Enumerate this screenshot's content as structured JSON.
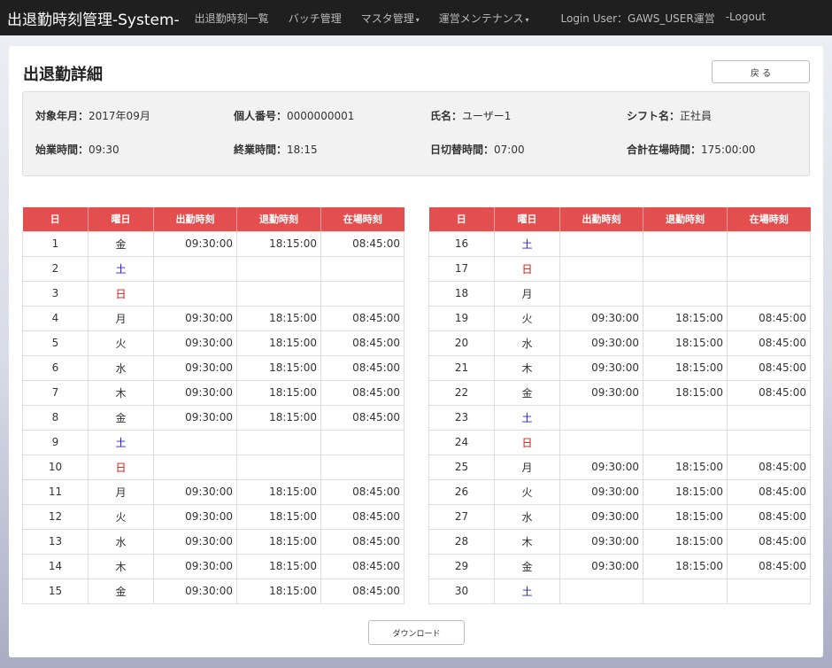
{
  "nav": {
    "brand": "出退勤時刻管理-System-",
    "items": [
      "出退勤時刻一覧",
      "バッチ管理",
      "マスタ管理",
      "運営メンテナンス"
    ],
    "caret": "▾",
    "login": "Login User：GAWS_USER運営",
    "logout": "-Logout"
  },
  "page": {
    "title": "出退勤詳細",
    "back_label": "戻 る",
    "download_label": "ダウンロード"
  },
  "info": {
    "month_label": "対象年月：",
    "month": "2017年09月",
    "id_label": "個人番号：",
    "id": "0000000001",
    "name_label": "氏名：",
    "name": "ユーザー1",
    "shift_label": "シフト名：",
    "shift": "正社員",
    "start_label": "始業時間：",
    "start": "09:30",
    "end_label": "終業時間：",
    "end": "18:15",
    "daycut_label": "日切替時間：",
    "daycut": "07:00",
    "total_label": "合計在場時間：",
    "total": "175:00:00"
  },
  "table": {
    "headers": [
      "日",
      "曜日",
      "出勤時刻",
      "退勤時刻",
      "在場時刻"
    ],
    "left_rows": [
      [
        "1",
        "金",
        "09:30:00",
        "18:15:00",
        "08:45:00"
      ],
      [
        "2",
        "土",
        "",
        "",
        ""
      ],
      [
        "3",
        "日",
        "",
        "",
        ""
      ],
      [
        "4",
        "月",
        "09:30:00",
        "18:15:00",
        "08:45:00"
      ],
      [
        "5",
        "火",
        "09:30:00",
        "18:15:00",
        "08:45:00"
      ],
      [
        "6",
        "水",
        "09:30:00",
        "18:15:00",
        "08:45:00"
      ],
      [
        "7",
        "木",
        "09:30:00",
        "18:15:00",
        "08:45:00"
      ],
      [
        "8",
        "金",
        "09:30:00",
        "18:15:00",
        "08:45:00"
      ],
      [
        "9",
        "土",
        "",
        "",
        ""
      ],
      [
        "10",
        "日",
        "",
        "",
        ""
      ],
      [
        "11",
        "月",
        "09:30:00",
        "18:15:00",
        "08:45:00"
      ],
      [
        "12",
        "火",
        "09:30:00",
        "18:15:00",
        "08:45:00"
      ],
      [
        "13",
        "水",
        "09:30:00",
        "18:15:00",
        "08:45:00"
      ],
      [
        "14",
        "木",
        "09:30:00",
        "18:15:00",
        "08:45:00"
      ],
      [
        "15",
        "金",
        "09:30:00",
        "18:15:00",
        "08:45:00"
      ]
    ],
    "right_rows": [
      [
        "16",
        "土",
        "",
        "",
        ""
      ],
      [
        "17",
        "日",
        "",
        "",
        ""
      ],
      [
        "18",
        "月",
        "",
        "",
        ""
      ],
      [
        "19",
        "火",
        "09:30:00",
        "18:15:00",
        "08:45:00"
      ],
      [
        "20",
        "水",
        "09:30:00",
        "18:15:00",
        "08:45:00"
      ],
      [
        "21",
        "木",
        "09:30:00",
        "18:15:00",
        "08:45:00"
      ],
      [
        "22",
        "金",
        "09:30:00",
        "18:15:00",
        "08:45:00"
      ],
      [
        "23",
        "土",
        "",
        "",
        ""
      ],
      [
        "24",
        "日",
        "",
        "",
        ""
      ],
      [
        "25",
        "月",
        "09:30:00",
        "18:15:00",
        "08:45:00"
      ],
      [
        "26",
        "火",
        "09:30:00",
        "18:15:00",
        "08:45:00"
      ],
      [
        "27",
        "水",
        "09:30:00",
        "18:15:00",
        "08:45:00"
      ],
      [
        "28",
        "木",
        "09:30:00",
        "18:15:00",
        "08:45:00"
      ],
      [
        "29",
        "金",
        "09:30:00",
        "18:15:00",
        "08:45:00"
      ],
      [
        "30",
        "土",
        "",
        "",
        ""
      ]
    ]
  },
  "colors": {
    "header_red": "#e34e4e",
    "saturday": "#1a1aff",
    "sunday": "#e01010",
    "navbar": "#1f1f1f"
  }
}
